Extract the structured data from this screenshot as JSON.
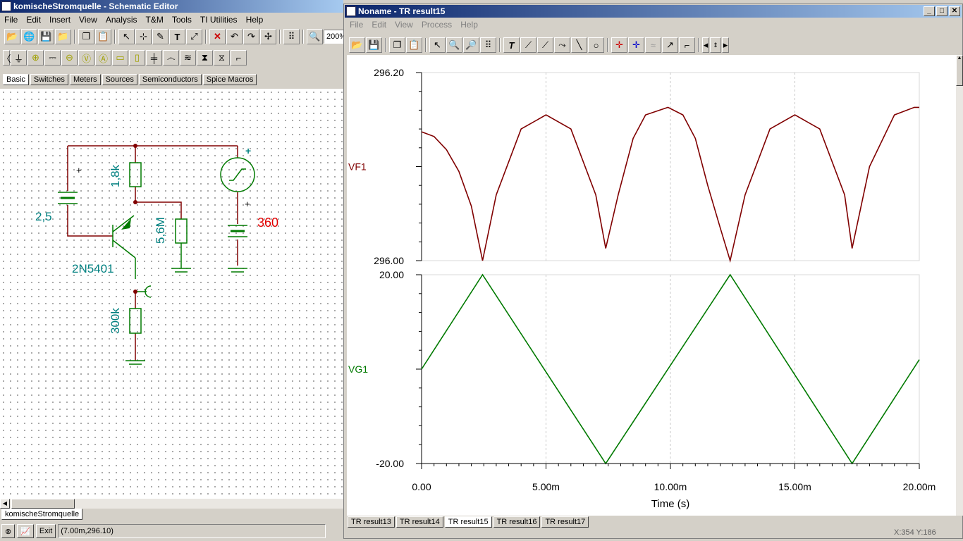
{
  "schematic_window": {
    "title": "komischeStromquelle - Schematic Editor",
    "menu": [
      "File",
      "Edit",
      "Insert",
      "View",
      "Analysis",
      "T&M",
      "Tools",
      "TI Utilities",
      "Help"
    ],
    "zoom": "200%",
    "component_tabs": [
      "Basic",
      "Switches",
      "Meters",
      "Sources",
      "Semiconductors",
      "Spice Macros"
    ],
    "active_tab": "Basic",
    "doc_tab": "komischeStromquelle",
    "status_coords": "(7.00m,296.10)",
    "exit_label": "Exit",
    "components": {
      "battery_value": "2,5",
      "resistor_top": "1,8k",
      "resistor_mid": "5,6M",
      "resistor_bottom": "300k",
      "transistor": "2N5401",
      "battery_right": "360",
      "plus_sign": "+"
    }
  },
  "result_window": {
    "title": "Noname - TR result15",
    "menu": [
      "File",
      "Edit",
      "View",
      "Process",
      "Help"
    ],
    "result_tabs": [
      "TR result13",
      "TR result14",
      "TR result15",
      "TR result16",
      "TR result17"
    ],
    "active_result": "TR result15",
    "status_partial": "X:354 Y:186"
  },
  "chart_data": [
    {
      "type": "line",
      "series": [
        {
          "name": "VF1",
          "color": "#800000",
          "x": [
            0,
            0.5,
            1.0,
            1.5,
            2.0,
            2.45,
            3.0,
            4.0,
            5.0,
            6.0,
            7.0,
            7.4,
            7.9,
            8.5,
            9.0,
            9.9,
            10.5,
            11.0,
            11.5,
            12.0,
            12.4,
            13.0,
            14.0,
            15.0,
            16.0,
            17.0,
            17.3,
            18.0,
            19.0,
            19.8,
            20.0
          ],
          "y": [
            296.137,
            296.132,
            296.118,
            296.095,
            296.058,
            296.0,
            296.07,
            296.14,
            296.155,
            296.14,
            296.07,
            296.013,
            296.07,
            296.13,
            296.155,
            296.163,
            296.155,
            296.13,
            296.08,
            296.035,
            296.0,
            296.07,
            296.14,
            296.155,
            296.14,
            296.07,
            296.013,
            296.1,
            296.155,
            296.163,
            296.163
          ]
        }
      ],
      "ylabel": "VF1",
      "ylim": [
        296.0,
        296.2
      ],
      "ytick_labels": [
        "296.20",
        "296.00"
      ]
    },
    {
      "type": "line",
      "series": [
        {
          "name": "VG1",
          "color": "#007a00",
          "x": [
            0,
            2.45,
            7.4,
            12.4,
            17.3,
            20.0
          ],
          "y": [
            0,
            20,
            -20,
            20,
            -20,
            2
          ]
        }
      ],
      "ylabel": "VG1",
      "ylim": [
        -20,
        20
      ],
      "ytick_labels": [
        "20.00",
        "-20.00"
      ],
      "xlim": [
        0,
        20
      ],
      "xtick_labels": [
        "0.00",
        "5.00m",
        "10.00m",
        "15.00m",
        "20.00m"
      ],
      "xlabel": "Time (s)"
    }
  ]
}
